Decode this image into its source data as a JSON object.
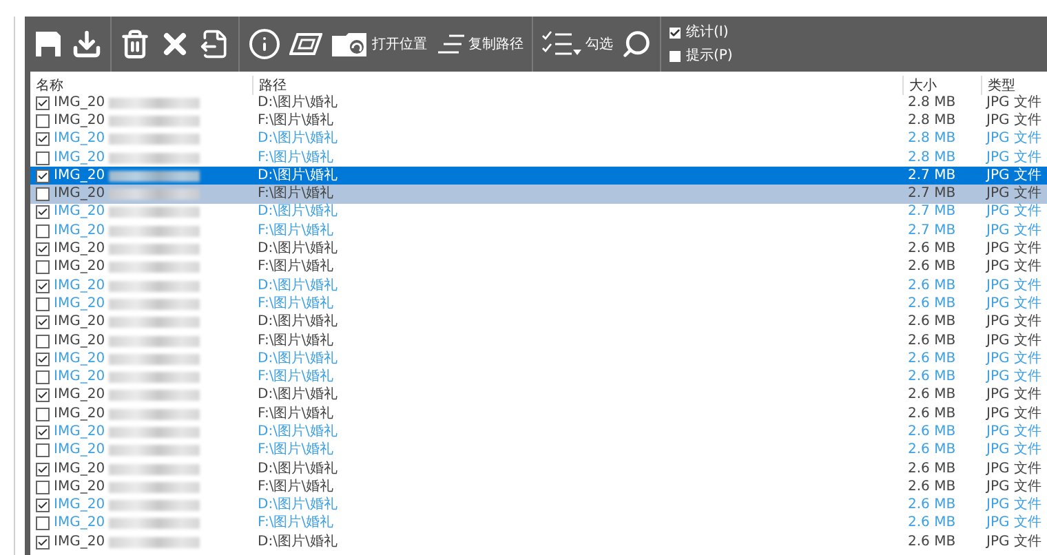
{
  "toolbar": {
    "open_location_label": "打开位置",
    "copy_path_label": "复制路径",
    "check_label": "勾选",
    "options": [
      {
        "label": "统计(I)",
        "checked": true
      },
      {
        "label": "提示(P)",
        "checked": false
      }
    ]
  },
  "table": {
    "columns": [
      "名称",
      "路径",
      "大小",
      "类型"
    ],
    "rows": [
      {
        "name": "IMG_20",
        "path": "D:\\图片\\婚礼",
        "size": "2.8 MB",
        "type": "JPG 文件",
        "checked": true,
        "color": "#444444",
        "selected": false,
        "hovered": false
      },
      {
        "name": "IMG_20",
        "path": "F:\\图片\\婚礼",
        "size": "2.8 MB",
        "type": "JPG 文件",
        "checked": false,
        "color": "#444444",
        "selected": false,
        "hovered": false
      },
      {
        "name": "IMG_20",
        "path": "D:\\图片\\婚礼",
        "size": "2.8 MB",
        "type": "JPG 文件",
        "checked": true,
        "color": "#3ca0e6",
        "selected": false,
        "hovered": false
      },
      {
        "name": "IMG_20",
        "path": "F:\\图片\\婚礼",
        "size": "2.8 MB",
        "type": "JPG 文件",
        "checked": false,
        "color": "#3ca0e6",
        "selected": false,
        "hovered": false
      },
      {
        "name": "IMG_20",
        "path": "D:\\图片\\婚礼",
        "size": "2.7 MB",
        "type": "JPG 文件",
        "checked": true,
        "color": "#ffffff",
        "selected": true,
        "hovered": false
      },
      {
        "name": "IMG_20",
        "path": "F:\\图片\\婚礼",
        "size": "2.7 MB",
        "type": "JPG 文件",
        "checked": false,
        "color": "#444444",
        "selected": false,
        "hovered": true
      },
      {
        "name": "IMG_20",
        "path": "D:\\图片\\婚礼",
        "size": "2.7 MB",
        "type": "JPG 文件",
        "checked": true,
        "color": "#3ca0e6",
        "selected": false,
        "hovered": false
      },
      {
        "name": "IMG_20",
        "path": "F:\\图片\\婚礼",
        "size": "2.7 MB",
        "type": "JPG 文件",
        "checked": false,
        "color": "#3ca0e6",
        "selected": false,
        "hovered": false
      },
      {
        "name": "IMG_20",
        "path": "D:\\图片\\婚礼",
        "size": "2.6 MB",
        "type": "JPG 文件",
        "checked": true,
        "color": "#444444",
        "selected": false,
        "hovered": false
      },
      {
        "name": "IMG_20",
        "path": "F:\\图片\\婚礼",
        "size": "2.6 MB",
        "type": "JPG 文件",
        "checked": false,
        "color": "#444444",
        "selected": false,
        "hovered": false
      },
      {
        "name": "IMG_20",
        "path": "D:\\图片\\婚礼",
        "size": "2.6 MB",
        "type": "JPG 文件",
        "checked": true,
        "color": "#3ca0e6",
        "selected": false,
        "hovered": false
      },
      {
        "name": "IMG_20",
        "path": "F:\\图片\\婚礼",
        "size": "2.6 MB",
        "type": "JPG 文件",
        "checked": false,
        "color": "#3ca0e6",
        "selected": false,
        "hovered": false
      },
      {
        "name": "IMG_20",
        "path": "D:\\图片\\婚礼",
        "size": "2.6 MB",
        "type": "JPG 文件",
        "checked": true,
        "color": "#444444",
        "selected": false,
        "hovered": false
      },
      {
        "name": "IMG_20",
        "path": "F:\\图片\\婚礼",
        "size": "2.6 MB",
        "type": "JPG 文件",
        "checked": false,
        "color": "#444444",
        "selected": false,
        "hovered": false
      },
      {
        "name": "IMG_20",
        "path": "D:\\图片\\婚礼",
        "size": "2.6 MB",
        "type": "JPG 文件",
        "checked": true,
        "color": "#3ca0e6",
        "selected": false,
        "hovered": false
      },
      {
        "name": "IMG_20",
        "path": "F:\\图片\\婚礼",
        "size": "2.6 MB",
        "type": "JPG 文件",
        "checked": false,
        "color": "#3ca0e6",
        "selected": false,
        "hovered": false
      },
      {
        "name": "IMG_20",
        "path": "D:\\图片\\婚礼",
        "size": "2.6 MB",
        "type": "JPG 文件",
        "checked": true,
        "color": "#444444",
        "selected": false,
        "hovered": false
      },
      {
        "name": "IMG_20",
        "path": "F:\\图片\\婚礼",
        "size": "2.6 MB",
        "type": "JPG 文件",
        "checked": false,
        "color": "#444444",
        "selected": false,
        "hovered": false
      },
      {
        "name": "IMG_20",
        "path": "D:\\图片\\婚礼",
        "size": "2.6 MB",
        "type": "JPG 文件",
        "checked": true,
        "color": "#3ca0e6",
        "selected": false,
        "hovered": false
      },
      {
        "name": "IMG_20",
        "path": "F:\\图片\\婚礼",
        "size": "2.6 MB",
        "type": "JPG 文件",
        "checked": false,
        "color": "#3ca0e6",
        "selected": false,
        "hovered": false
      },
      {
        "name": "IMG_20",
        "path": "D:\\图片\\婚礼",
        "size": "2.6 MB",
        "type": "JPG 文件",
        "checked": true,
        "color": "#444444",
        "selected": false,
        "hovered": false
      },
      {
        "name": "IMG_20",
        "path": "F:\\图片\\婚礼",
        "size": "2.6 MB",
        "type": "JPG 文件",
        "checked": false,
        "color": "#444444",
        "selected": false,
        "hovered": false
      },
      {
        "name": "IMG_20",
        "path": "D:\\图片\\婚礼",
        "size": "2.6 MB",
        "type": "JPG 文件",
        "checked": true,
        "color": "#3ca0e6",
        "selected": false,
        "hovered": false
      },
      {
        "name": "IMG_20",
        "path": "F:\\图片\\婚礼",
        "size": "2.6 MB",
        "type": "JPG 文件",
        "checked": false,
        "color": "#3ca0e6",
        "selected": false,
        "hovered": false
      },
      {
        "name": "IMG_20",
        "path": "D:\\图片\\婚礼",
        "size": "2.6 MB",
        "type": "JPG 文件",
        "checked": true,
        "color": "#444444",
        "selected": false,
        "hovered": false
      }
    ]
  }
}
